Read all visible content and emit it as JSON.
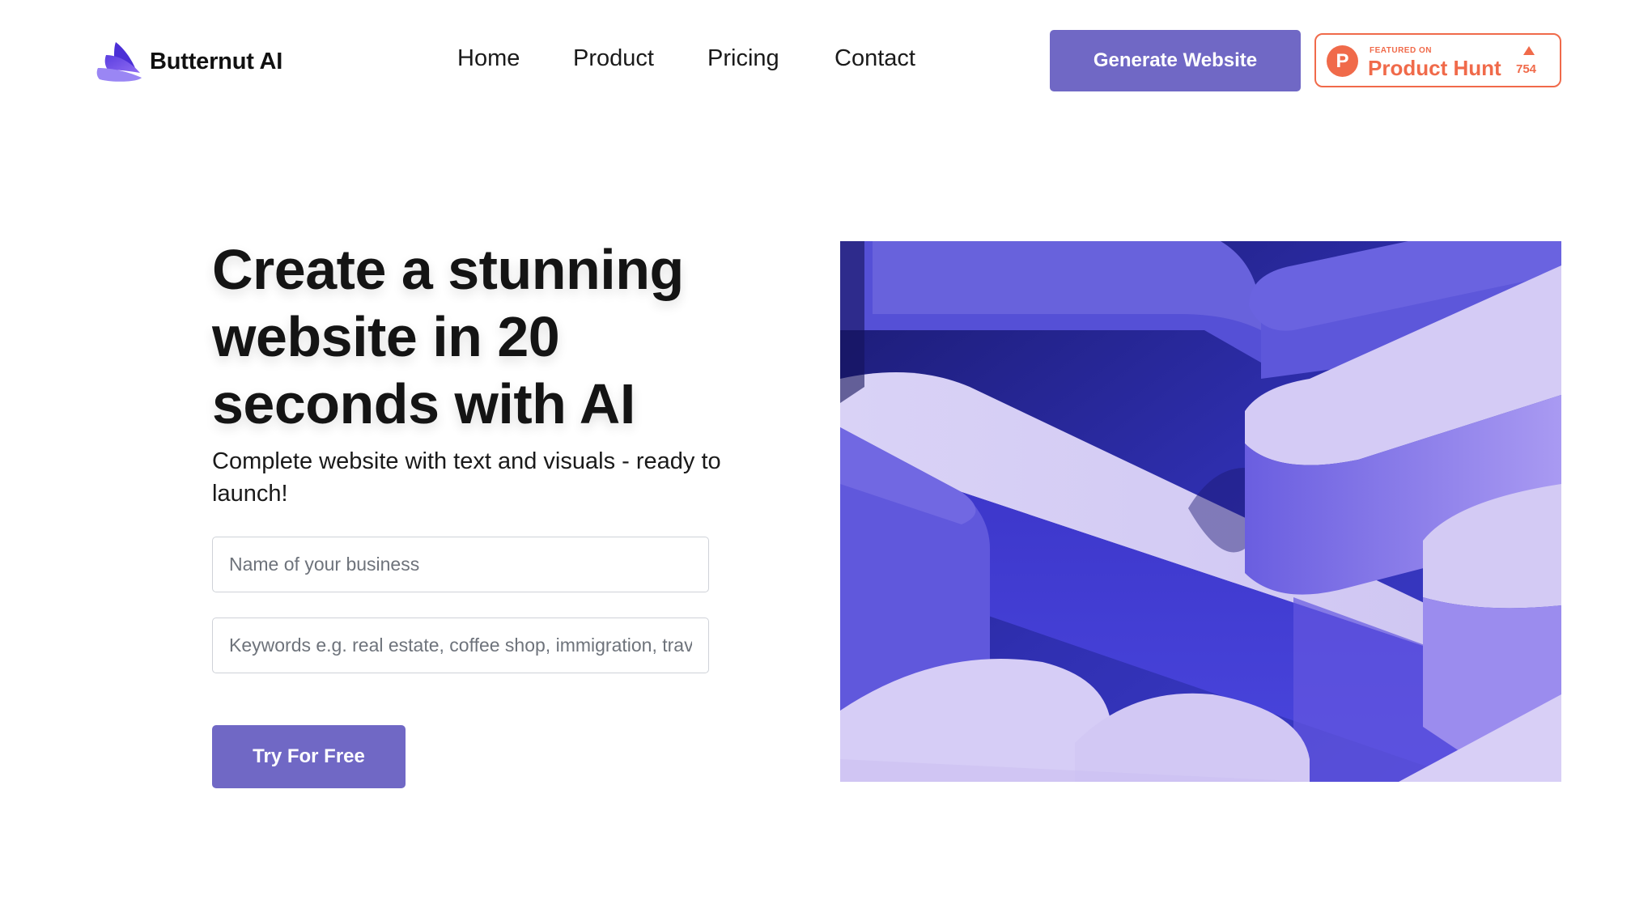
{
  "brand": {
    "name": "Butternut AI",
    "logo_icon": "butternut-wing-icon",
    "accent_color": "#7068c5"
  },
  "nav": {
    "items": [
      {
        "label": "Home"
      },
      {
        "label": "Product"
      },
      {
        "label": "Pricing"
      },
      {
        "label": "Contact"
      }
    ]
  },
  "header": {
    "cta_label": "Generate Website"
  },
  "product_hunt": {
    "featured_label": "FEATURED ON",
    "name": "Product Hunt",
    "upvotes": "754",
    "color": "#f06a4a",
    "icon": "product-hunt-icon",
    "arrow_icon": "upvote-triangle-icon"
  },
  "hero": {
    "headline": "Create a stunning website in 20 seconds with AI",
    "subline": "Complete website with text and visuals - ready to launch!",
    "business_placeholder": "Name of your business",
    "keywords_placeholder": "Keywords e.g. real estate, coffee shop, immigration, travel",
    "cta_label": "Try For Free",
    "image": "abstract-3d-purple-shapes"
  }
}
